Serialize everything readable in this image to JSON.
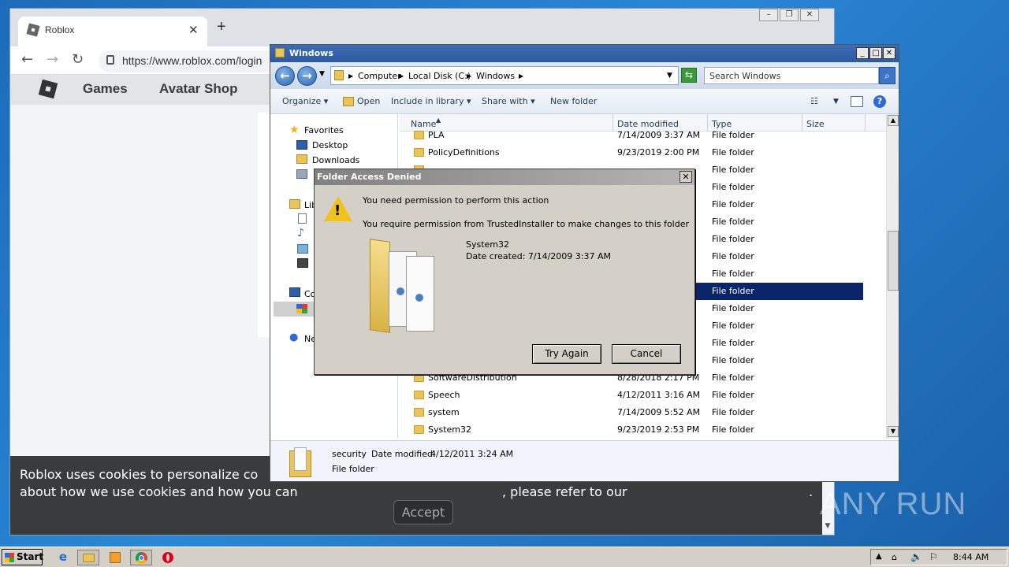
{
  "browser": {
    "tab_title": "Roblox",
    "tab_close": "✕",
    "new_tab": "+",
    "url": "https://www.roblox.com/login",
    "nav": {
      "back": "←",
      "forward": "→",
      "reload": "↻"
    }
  },
  "roblox": {
    "nav_items": [
      "Games",
      "Avatar Shop"
    ],
    "cookie_line1": " Roblox uses cookies to personalize co",
    "cookie_line2a": "about how we use cookies and how you can",
    "cookie_line2b": ", please refer to our",
    "cookie_dot": ".",
    "accept_label": "Accept"
  },
  "explorer": {
    "title": "Windows",
    "breadcrumb": [
      "Computer",
      "Local Disk (C:)",
      "Windows"
    ],
    "search_placeholder": "Search Windows",
    "toolbar": {
      "organize": "Organize",
      "open": "Open",
      "include": "Include in library",
      "share": "Share with",
      "new_folder": "New folder"
    },
    "nav": {
      "favorites": "Favorites",
      "desktop": "Desktop",
      "downloads": "Downloads",
      "libraries": "Lib",
      "computer": "Co",
      "network": "Ne"
    },
    "columns": {
      "name": "Name",
      "date": "Date modified",
      "type": "Type",
      "size": "Size"
    },
    "rows": [
      {
        "name": "PLA",
        "date": "7/14/2009 3:37 AM",
        "type": "File folder"
      },
      {
        "name": "PolicyDefinitions",
        "date": "9/23/2019 2:00 PM",
        "type": "File folder"
      },
      {
        "name": "",
        "date": "",
        "type": "File folder"
      },
      {
        "name": "",
        "date": "",
        "type": "File folder"
      },
      {
        "name": "",
        "date": "",
        "type": "File folder"
      },
      {
        "name": "",
        "date": "",
        "type": "File folder"
      },
      {
        "name": "",
        "date": "",
        "type": "File folder"
      },
      {
        "name": "",
        "date": "",
        "type": "File folder"
      },
      {
        "name": "",
        "date": "",
        "type": "File folder"
      },
      {
        "name": "",
        "date": "",
        "type": "File folder",
        "selected": true
      },
      {
        "name": "",
        "date": "",
        "type": "File folder"
      },
      {
        "name": "",
        "date": "",
        "type": "File folder"
      },
      {
        "name": "",
        "date": "",
        "type": "File folder"
      },
      {
        "name": "",
        "date": "",
        "type": "File folder"
      },
      {
        "name": "SoftwareDistribution",
        "date": "8/28/2018 2:17 PM",
        "type": "File folder"
      },
      {
        "name": "Speech",
        "date": "4/12/2011 3:16 AM",
        "type": "File folder"
      },
      {
        "name": "system",
        "date": "7/14/2009 5:52 AM",
        "type": "File folder"
      },
      {
        "name": "System32",
        "date": "9/23/2019 2:53 PM",
        "type": "File folder"
      }
    ],
    "details": {
      "name": "security",
      "date_label": "Date modified:",
      "date": "4/12/2011 3:24 AM",
      "type": "File folder"
    }
  },
  "dialog": {
    "title": "Folder Access Denied",
    "close": "✕",
    "message1": "You need permission to perform this action",
    "message2": "You require permission from TrustedInstaller to make changes to this folder",
    "folder_name": "System32",
    "date_created": "Date created: 7/14/2009 3:37 AM",
    "try_again": "Try Again",
    "cancel": "Cancel"
  },
  "taskbar": {
    "start": "Start",
    "clock": "8:44 AM"
  },
  "watermark": "ANY RUN"
}
